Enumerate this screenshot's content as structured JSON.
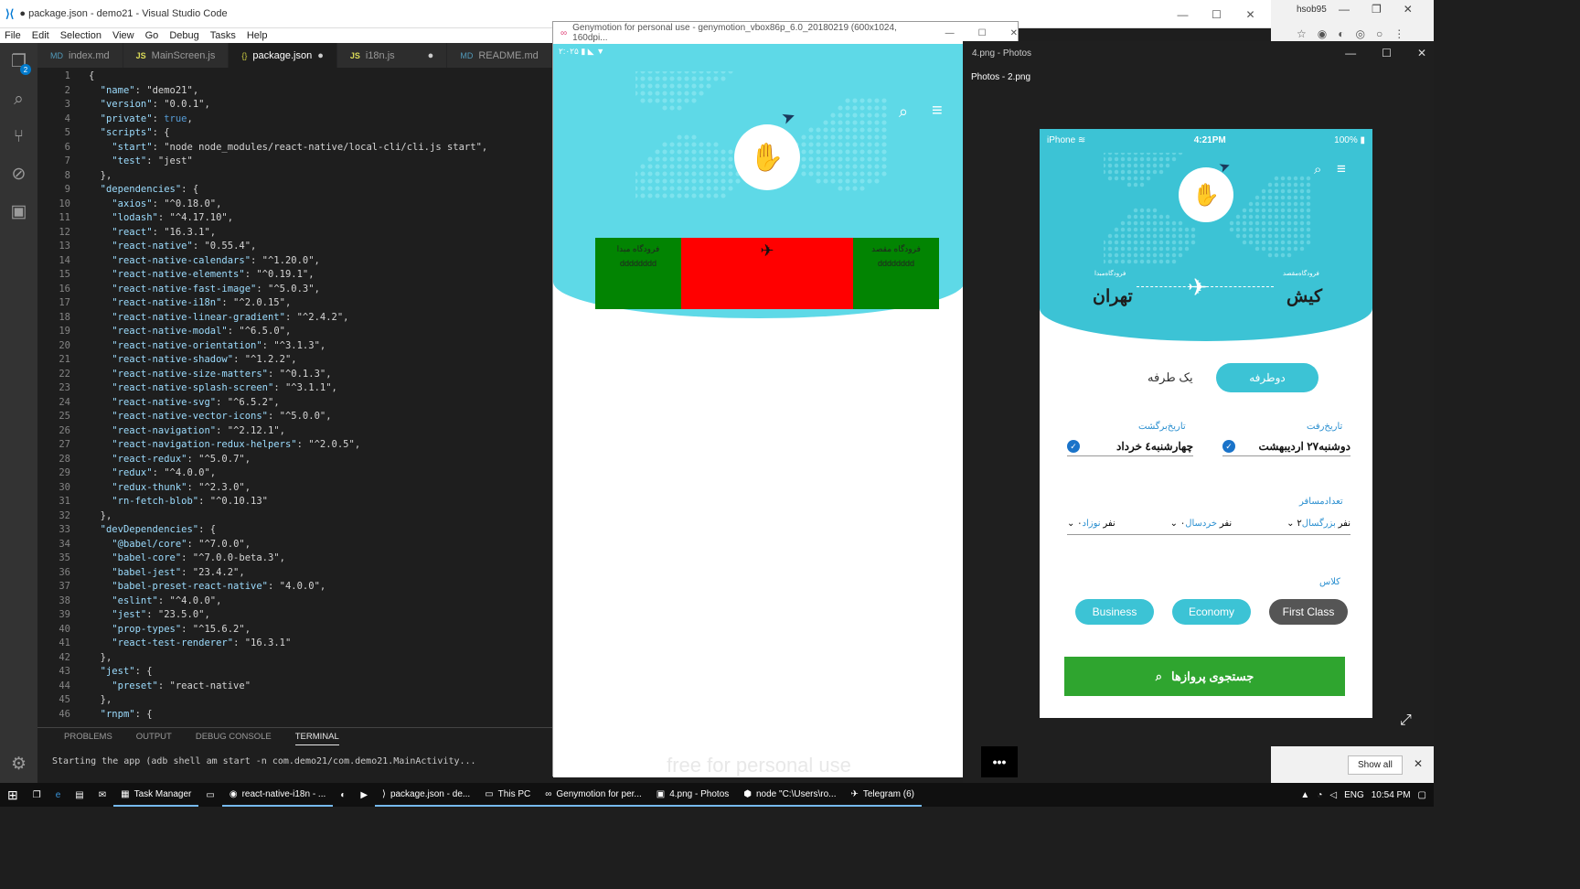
{
  "vscode": {
    "title": "● package.json - demo21 - Visual Studio Code",
    "menu": [
      "File",
      "Edit",
      "Selection",
      "View",
      "Go",
      "Debug",
      "Tasks",
      "Help"
    ],
    "tabs": [
      {
        "label": "index.md",
        "kind": "md"
      },
      {
        "label": "MainScreen.js",
        "kind": "js"
      },
      {
        "label": "package.json",
        "kind": "json",
        "active": true,
        "dirty": true
      },
      {
        "label": "i18n.js",
        "kind": "js",
        "dirty": true
      },
      {
        "label": "README.md",
        "kind": "md"
      },
      {
        "label": "JS",
        "kind": "js"
      }
    ],
    "scm_badge": "2",
    "code_lines": [
      "{",
      "  \"name\": \"demo21\",",
      "  \"version\": \"0.0.1\",",
      "  \"private\": true,",
      "  \"scripts\": {",
      "    \"start\": \"node node_modules/react-native/local-cli/cli.js start\",",
      "    \"test\": \"jest\"",
      "  },",
      "  \"dependencies\": {",
      "    \"axios\": \"^0.18.0\",",
      "    \"lodash\": \"^4.17.10\",",
      "    \"react\": \"16.3.1\",",
      "    \"react-native\": \"0.55.4\",",
      "    \"react-native-calendars\": \"^1.20.0\",",
      "    \"react-native-elements\": \"^0.19.1\",",
      "    \"react-native-fast-image\": \"^5.0.3\",",
      "    \"react-native-i18n\": \"^2.0.15\",",
      "    \"react-native-linear-gradient\": \"^2.4.2\",",
      "    \"react-native-modal\": \"^6.5.0\",",
      "    \"react-native-orientation\": \"^3.1.3\",",
      "    \"react-native-shadow\": \"^1.2.2\",",
      "    \"react-native-size-matters\": \"^0.1.3\",",
      "    \"react-native-splash-screen\": \"^3.1.1\",",
      "    \"react-native-svg\": \"^6.5.2\",",
      "    \"react-native-vector-icons\": \"^5.0.0\",",
      "    \"react-navigation\": \"^2.12.1\",",
      "    \"react-navigation-redux-helpers\": \"^2.0.5\",",
      "    \"react-redux\": \"^5.0.7\",",
      "    \"redux\": \"^4.0.0\",",
      "    \"redux-thunk\": \"^2.3.0\",",
      "    \"rn-fetch-blob\": \"^0.10.13\"",
      "  },",
      "  \"devDependencies\": {",
      "    \"@babel/core\": \"^7.0.0\",",
      "    \"babel-core\": \"^7.0.0-beta.3\",",
      "    \"babel-jest\": \"23.4.2\",",
      "    \"babel-preset-react-native\": \"4.0.0\",",
      "    \"eslint\": \"^4.0.0\",",
      "    \"jest\": \"23.5.0\",",
      "    \"prop-types\": \"^15.6.2\",",
      "    \"react-test-renderer\": \"16.3.1\"",
      "  },",
      "  \"jest\": {",
      "    \"preset\": \"react-native\"",
      "  },",
      "  \"rnpm\": {"
    ],
    "panel_tabs": [
      "PROBLEMS",
      "OUTPUT",
      "DEBUG CONSOLE",
      "TERMINAL"
    ],
    "terminal_text": "Starting the app (adb shell am start -n com.demo21/com.demo21.MainActivity..."
  },
  "genymotion": {
    "title": "Genymotion for personal use - genymotion_vbox86p_6.0_20180219 (600x1024, 160dpi...",
    "status_time": "۲:۰۲۵",
    "origin_label": "فرودگاه مبدا",
    "origin_value": "dddddddd",
    "dest_label": "فرودگاه مقصد",
    "dest_value": "dddddddd",
    "watermark": "free for personal use"
  },
  "photos": {
    "window_title": "4.png - Photos",
    "subtitle": "Photos - 2.png",
    "ios": {
      "carrier": "iPhone",
      "time": "4:21PM",
      "battery": "100%"
    },
    "from_label": "فرودگاه‌مبدا",
    "from_city": "تهران",
    "to_label": "فرودگاه‌مقصد",
    "to_city": "کیش",
    "roundtrip": "دوطرفه",
    "oneway": "یک طرفه",
    "depart_label": "تاریخ‌رفت",
    "depart_value": "دوشنبه۲۷ اردیبهشت",
    "return_label": "تاریخ‌برگشت",
    "return_value": "چهارشنبه٤ خرداد",
    "passengers_label": "تعدادمسافر",
    "adult_label": "بزرگسال",
    "adult_value": "۲نفر",
    "child_label": "خردسال",
    "child_value": "۰نفر",
    "infant_label": "نوزاد",
    "infant_value": "۰نفر",
    "class_label": "کلاس",
    "classes": [
      "Business",
      "Economy",
      "First Class"
    ],
    "search_label": "جستجوی پروازها",
    "show_all": "Show all"
  },
  "chrome": {
    "user": "hsob95"
  },
  "taskbar": {
    "items": [
      "Task Manager",
      "react-native-i18n - ...",
      "package.json - de...",
      "This PC",
      "Genymotion for per...",
      "4.png - Photos",
      "node  \"C:\\Users\\ro...",
      "Telegram (6)"
    ],
    "lang": "ENG",
    "clock": "10:54 PM"
  },
  "colors": {
    "accent": "#5ed9e7",
    "phone_header": "#3cc3d5",
    "search_green": "#2fa52f",
    "route_green": "#028402",
    "route_red": "#ff0000"
  }
}
